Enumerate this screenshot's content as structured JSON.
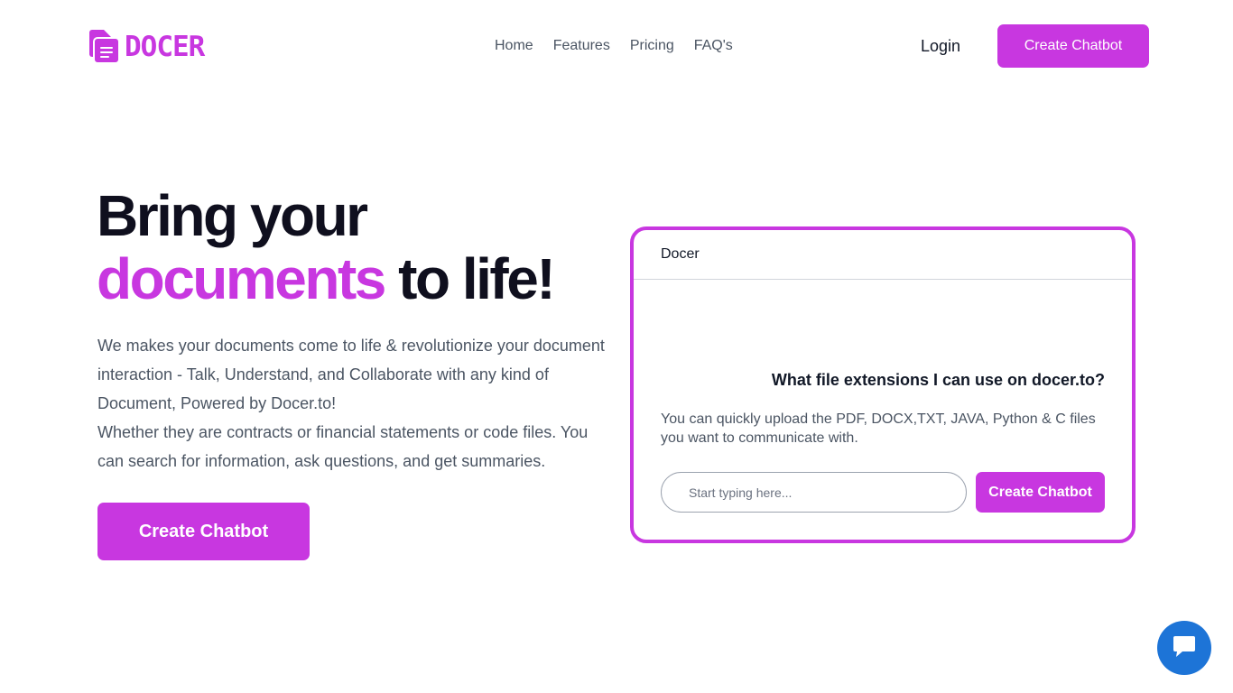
{
  "brand": {
    "name": "DOCER",
    "accent_color": "#c837e0"
  },
  "nav": {
    "items": [
      {
        "label": "Home"
      },
      {
        "label": "Features"
      },
      {
        "label": "Pricing"
      },
      {
        "label": "FAQ's"
      }
    ],
    "login_label": "Login",
    "cta_label": "Create Chatbot"
  },
  "hero": {
    "title_line1": "Bring your",
    "title_accent": "documents",
    "title_rest": " to life!",
    "description": [
      "We makes your documents come to life & revolutionize your document interaction - Talk, Understand, and Collaborate with any kind of Document, Powered by Docer.to!",
      "Whether they are contracts or financial statements or code files. You can search for information, ask questions, and get summaries."
    ],
    "cta_label": "Create Chatbot"
  },
  "chat_preview": {
    "header_title": "Docer",
    "question": "What file extensions I can use on docer.to?",
    "answer": "You can quickly upload the PDF, DOCX,TXT, JAVA, Python & C files you want to communicate with.",
    "input_placeholder": "Start typing here...",
    "button_label": "Create Chatbot"
  },
  "support_widget": {
    "icon": "chat-bubble-icon",
    "color": "#1d74d7"
  }
}
